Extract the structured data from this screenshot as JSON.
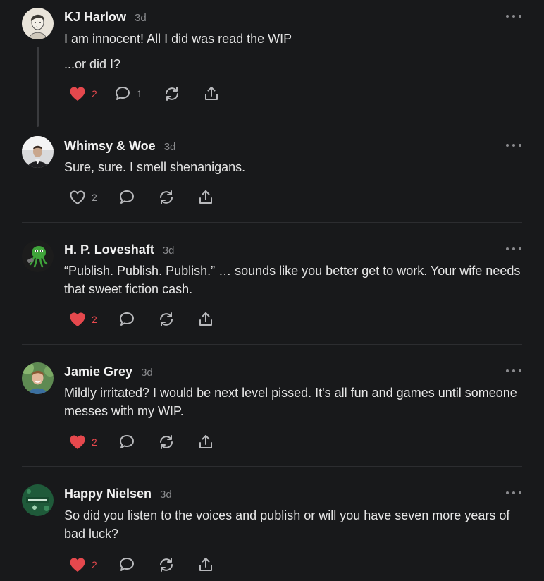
{
  "comments": [
    {
      "author": "KJ Harlow",
      "time": "3d",
      "lines": [
        "I am innocent! All I did was read the WIP",
        "...or did I?"
      ],
      "likes": "2",
      "liked": true,
      "replies": "1",
      "avatar_icon": "sketch-portrait-avatar",
      "accent": "#e5484d"
    },
    {
      "author": "Whimsy & Woe",
      "time": "3d",
      "text": "Sure, sure. I smell shenanigans.",
      "likes": "2",
      "liked": false,
      "avatar_icon": "photo-portrait-avatar"
    },
    {
      "author": "H. P. Loveshaft",
      "time": "3d",
      "text": "“Publish. Publish. Publish.” … sounds like you better get to work. Your wife needs that sweet fiction cash.",
      "likes": "2",
      "liked": true,
      "avatar_icon": "green-cthulhu-avatar"
    },
    {
      "author": "Jamie Grey",
      "time": "3d",
      "text": "Mildly irritated? I would be next level pissed. It's all fun and games until someone messes with my WIP.",
      "likes": "2",
      "liked": true,
      "avatar_icon": "photo-portrait-avatar"
    },
    {
      "author": "Happy Nielsen",
      "time": "3d",
      "text": "So did you listen to the voices and publish or will you have seven more years of bad luck?",
      "likes": "2",
      "liked": true,
      "avatar_icon": "green-card-avatar"
    }
  ]
}
